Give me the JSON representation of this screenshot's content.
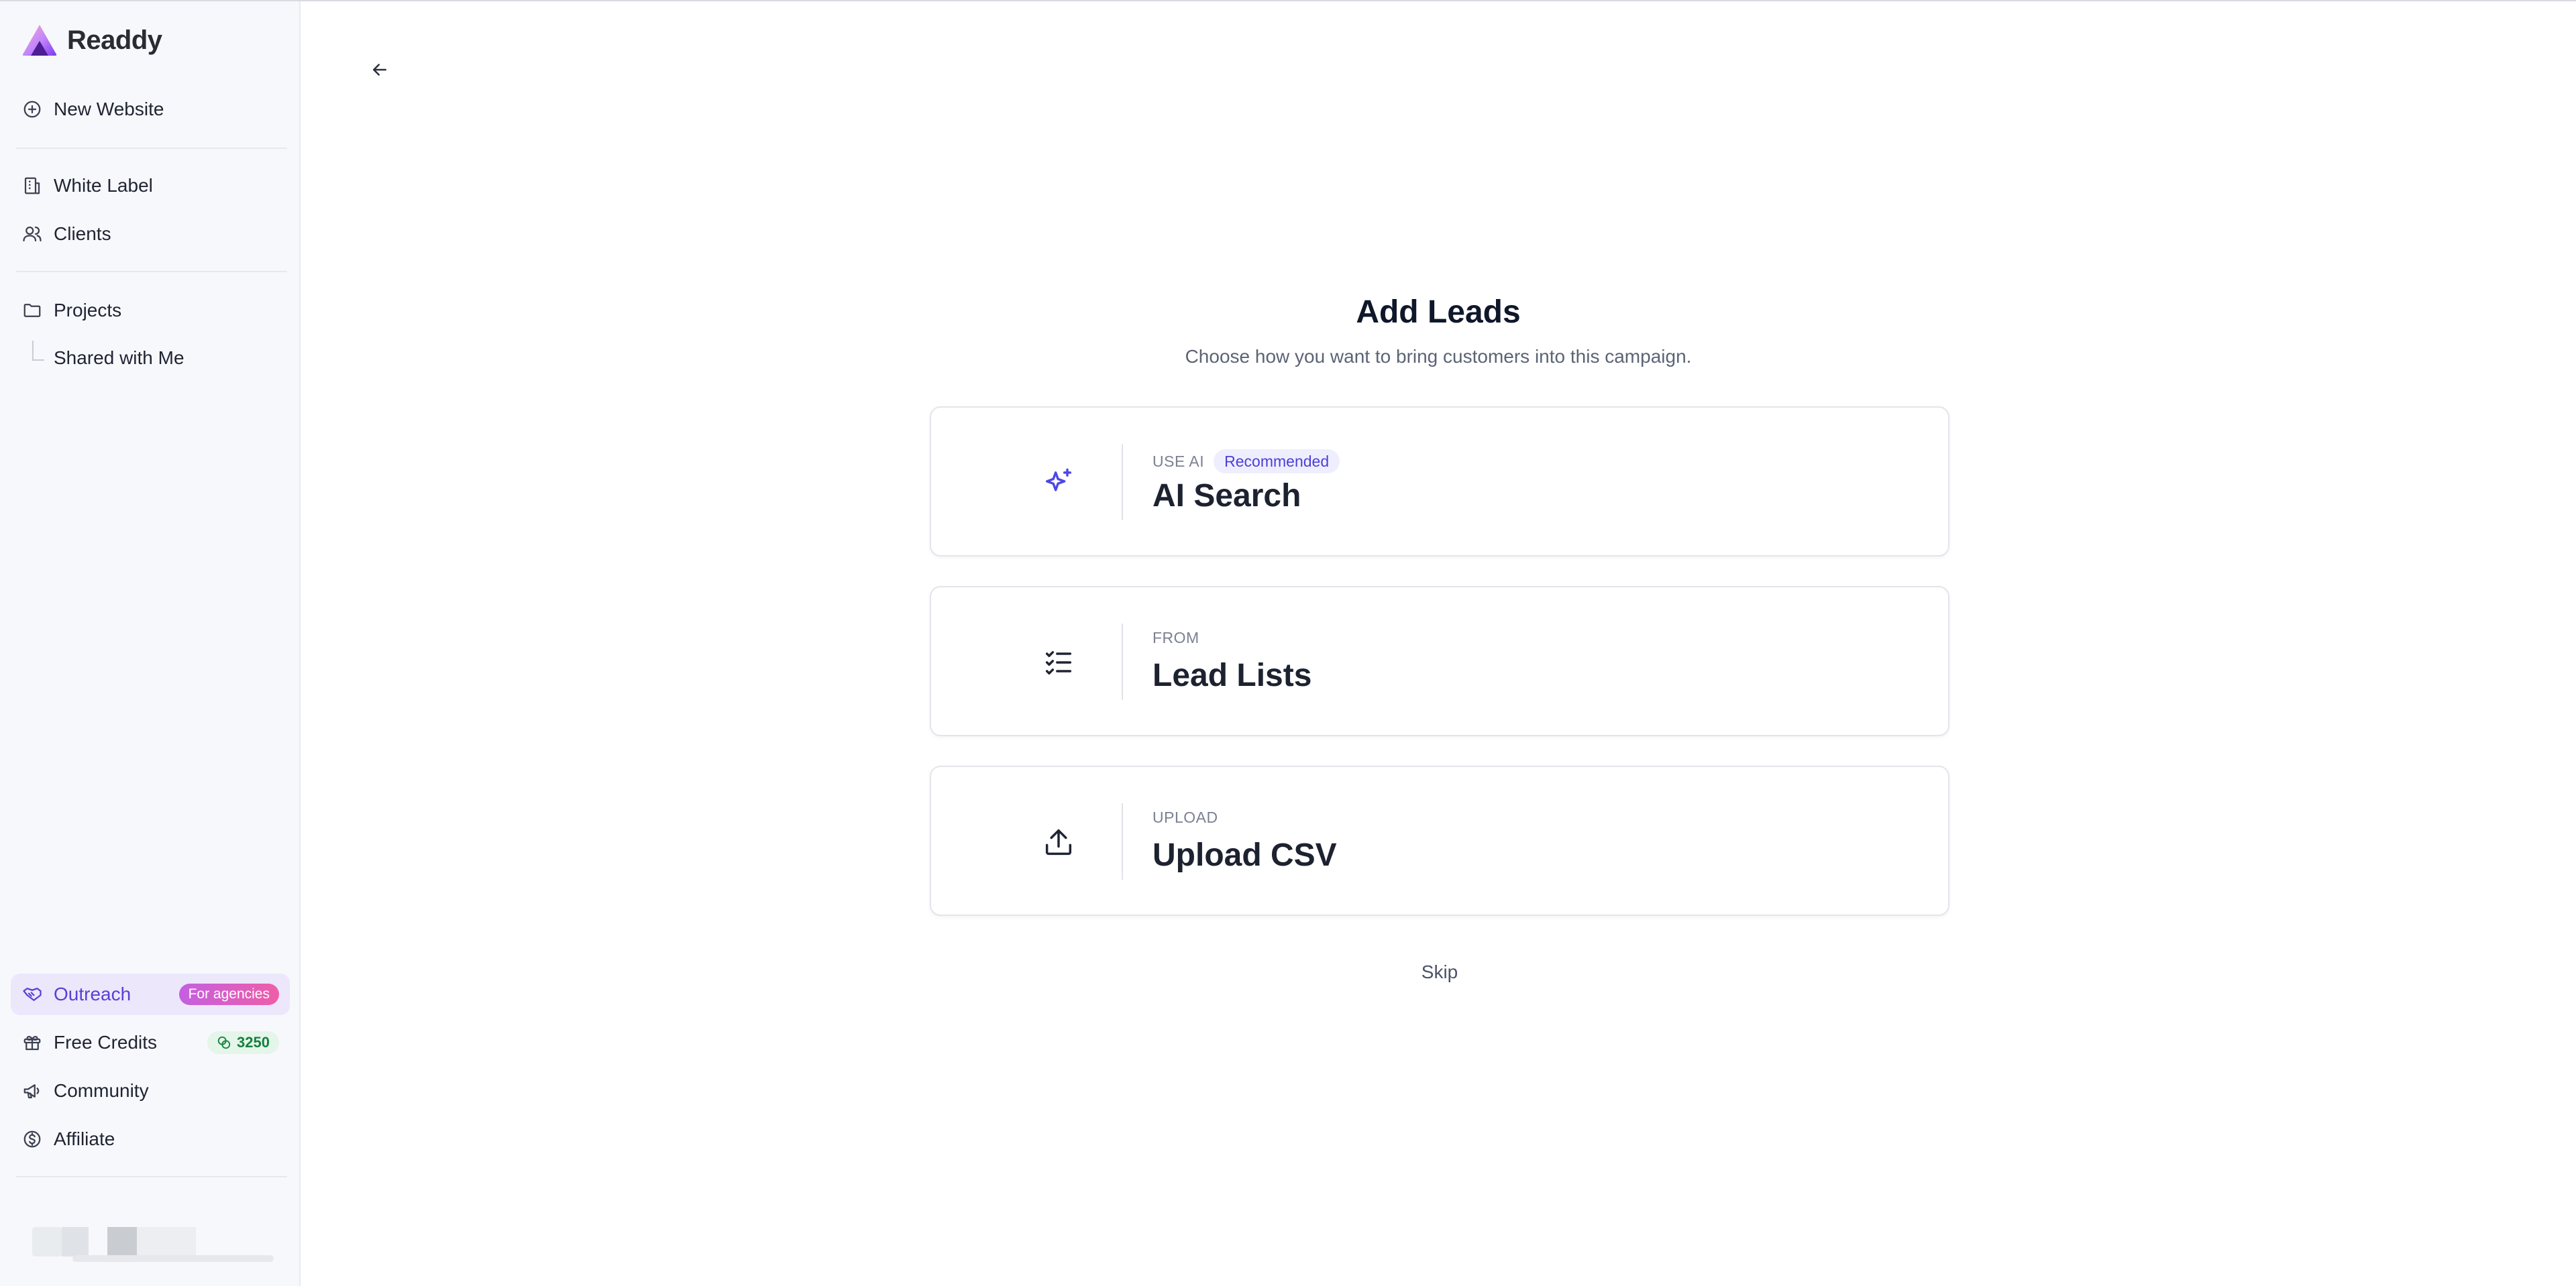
{
  "brand": {
    "name": "Readdy",
    "colors": {
      "logo_top": "#f472b6",
      "logo_mid": "#a78bfa",
      "logo_base": "#6d28d9"
    }
  },
  "sidebar": {
    "top_items": [
      {
        "label": "New Website",
        "icon": "plus-circle-icon"
      },
      {
        "label": "White Label",
        "icon": "building-icon"
      },
      {
        "label": "Clients",
        "icon": "users-icon"
      },
      {
        "label": "Projects",
        "icon": "folder-icon"
      }
    ],
    "projects_children": [
      {
        "label": "Shared with Me"
      }
    ],
    "bottom_items": [
      {
        "label": "Outreach",
        "icon": "handshake-icon",
        "badge": "For agencies",
        "active": true
      },
      {
        "label": "Free Credits",
        "icon": "gift-icon",
        "badge": "3250"
      },
      {
        "label": "Community",
        "icon": "megaphone-icon"
      },
      {
        "label": "Affiliate",
        "icon": "dollar-circle-icon"
      }
    ]
  },
  "main": {
    "back_icon": "arrow-left-icon",
    "title": "Add Leads",
    "subtitle": "Choose how you want to bring customers into this campaign.",
    "options": [
      {
        "eyebrow": "USE AI",
        "tag": "Recommended",
        "title": "AI Search",
        "icon": "sparkles-icon",
        "icon_color": "#4f46e5"
      },
      {
        "eyebrow": "FROM",
        "title": "Lead Lists",
        "icon": "checklist-icon"
      },
      {
        "eyebrow": "UPLOAD",
        "title": "Upload CSV",
        "icon": "upload-icon"
      }
    ],
    "skip_label": "Skip"
  },
  "colors": {
    "accent": "#5b3fd6",
    "active_bg": "#ece7fb",
    "credits_green": "#15803d",
    "agencies_badge_gradient": [
      "#c45fe0",
      "#ef5ea8"
    ]
  }
}
